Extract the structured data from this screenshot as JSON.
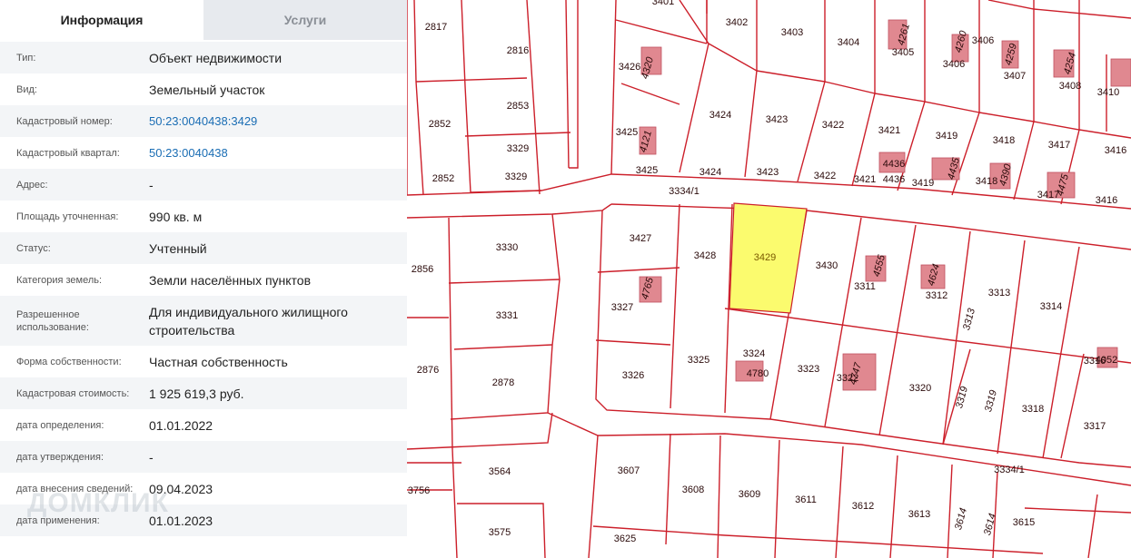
{
  "tabs": {
    "info": "Информация",
    "services": "Услуги"
  },
  "rows": [
    {
      "label": "Тип:",
      "value": "Объект недвижимости"
    },
    {
      "label": "Вид:",
      "value": "Земельный участок"
    },
    {
      "label": "Кадастровый номер:",
      "value": "50:23:0040438:3429"
    },
    {
      "label": "Кадастровый квартал:",
      "value": "50:23:0040438"
    },
    {
      "label": "Адрес:",
      "value": "-"
    },
    {
      "label": "Площадь уточненная:",
      "value": "990 кв. м"
    },
    {
      "label": "Статус:",
      "value": "Учтенный"
    },
    {
      "label": "Категория земель:",
      "value": "Земли населённых пунктов"
    },
    {
      "label": "Разрешенное использование:",
      "value": "Для индивидуального жилищного строительства"
    },
    {
      "label": "Форма собственности:",
      "value": "Частная собственность"
    },
    {
      "label": "Кадастровая стоимость:",
      "value": "1 925 619,3 руб."
    },
    {
      "label": "дата определения:",
      "value": "01.01.2022"
    },
    {
      "label": "дата утверждения:",
      "value": "-"
    },
    {
      "label": "дата внесения сведений:",
      "value": "09.04.2023"
    },
    {
      "label": "дата применения:",
      "value": "01.01.2023"
    }
  ],
  "watermark": "ДОМКЛИК",
  "colors": {
    "boundary": "#cc1f2a",
    "selected_fill": "#fbfb6e",
    "building_fill": "#e08890",
    "link": "#1a6db4"
  },
  "map": {
    "parcels": [
      "2817",
      "2816",
      "3401",
      "3402",
      "3403",
      "3404",
      "3405",
      "3406",
      "3406",
      "3407",
      "3408",
      "3410",
      "3426",
      "3425",
      "3425",
      "3424",
      "3424",
      "3423",
      "3423",
      "3422",
      "3422",
      "3421",
      "3421",
      "3419",
      "3419",
      "3418",
      "3418",
      "3417",
      "3417",
      "3416",
      "3416",
      "2852",
      "2852",
      "2853",
      "3329",
      "3329",
      "3334/1",
      "3330",
      "2856",
      "3331",
      "3427",
      "3428",
      "3429",
      "3430",
      "3311",
      "3312",
      "3313",
      "3313",
      "3314",
      "3327",
      "3326",
      "3325",
      "3324",
      "3323",
      "3322",
      "3320",
      "3319",
      "3319",
      "3318",
      "3316",
      "3317",
      "2876",
      "2878",
      "3564",
      "3756",
      "3575",
      "3607",
      "3608",
      "3609",
      "3611",
      "3612",
      "3613",
      "3614",
      "3614",
      "3615",
      "3625",
      "3334/1"
    ],
    "buildings": [
      "4261",
      "4260",
      "4259",
      "4254",
      "4320",
      "4121",
      "4436",
      "4436",
      "4435",
      "4390",
      "4475",
      "4555",
      "4624",
      "4765",
      "4780",
      "4052",
      "4747"
    ]
  }
}
